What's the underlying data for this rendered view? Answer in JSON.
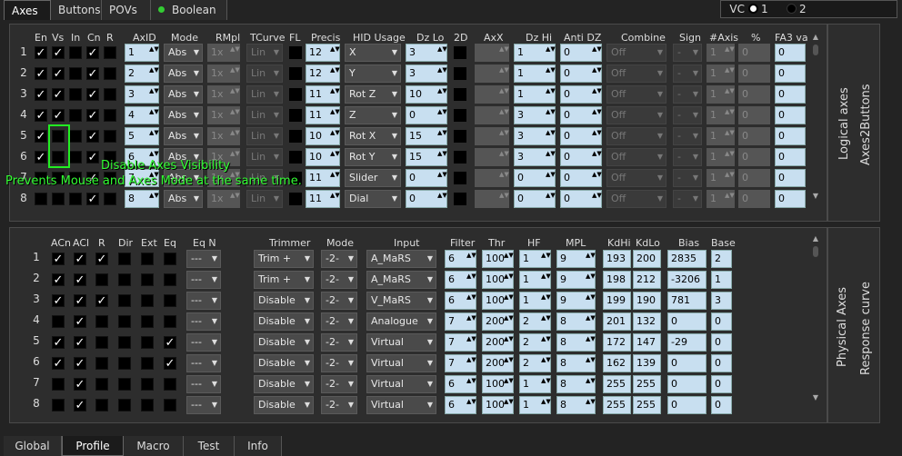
{
  "top_tabs": [
    "Axes",
    "Buttons",
    "POVs",
    "Boolean"
  ],
  "vc": {
    "label": "VC",
    "opt1": "1",
    "opt2": "2"
  },
  "logical": {
    "side_title1": "Logical axes",
    "side_title2": "Axes2Buttons",
    "headers": [
      "En",
      "Vs",
      "In",
      "Cn",
      "R",
      "AxID",
      "Mode",
      "RMpl",
      "TCurve",
      "FL",
      "Precis",
      "HID Usage",
      "Dz Lo",
      "2D",
      "AxX",
      "Dz Hi",
      "Anti DZ",
      "Combine",
      "Sign",
      "#Axis",
      "%",
      "FA3 va"
    ],
    "rows": [
      {
        "n": "1",
        "en": "✓",
        "vs": "✓",
        "in": "",
        "cn": "✓",
        "r": "",
        "axid": "1",
        "mode": "Abs",
        "rmpl": "1x",
        "tcurve": "Lin",
        "precis": "12",
        "hid": "X",
        "dzlo": "3",
        "axx": "",
        "dzhi": "1",
        "antidz": "0",
        "combine": "Off",
        "sign": "-",
        "naxis": "1",
        "pct": "0",
        "fa3": "0"
      },
      {
        "n": "2",
        "en": "✓",
        "vs": "✓",
        "in": "",
        "cn": "✓",
        "r": "",
        "axid": "2",
        "mode": "Abs",
        "rmpl": "1x",
        "tcurve": "Lin",
        "precis": "12",
        "hid": "Y",
        "dzlo": "3",
        "axx": "",
        "dzhi": "1",
        "antidz": "0",
        "combine": "Off",
        "sign": "-",
        "naxis": "1",
        "pct": "0",
        "fa3": "0"
      },
      {
        "n": "3",
        "en": "✓",
        "vs": "✓",
        "in": "",
        "cn": "✓",
        "r": "",
        "axid": "3",
        "mode": "Abs",
        "rmpl": "1x",
        "tcurve": "Lin",
        "precis": "11",
        "hid": "Rot Z",
        "dzlo": "10",
        "axx": "",
        "dzhi": "1",
        "antidz": "0",
        "combine": "Off",
        "sign": "-",
        "naxis": "1",
        "pct": "0",
        "fa3": "0"
      },
      {
        "n": "4",
        "en": "✓",
        "vs": "✓",
        "in": "",
        "cn": "✓",
        "r": "",
        "axid": "4",
        "mode": "Abs",
        "rmpl": "1x",
        "tcurve": "Lin",
        "precis": "11",
        "hid": "Z",
        "dzlo": "0",
        "axx": "",
        "dzhi": "3",
        "antidz": "0",
        "combine": "Off",
        "sign": "-",
        "naxis": "1",
        "pct": "0",
        "fa3": "0"
      },
      {
        "n": "5",
        "en": "✓",
        "vs": "",
        "in": "",
        "cn": "✓",
        "r": "",
        "axid": "5",
        "mode": "Abs",
        "rmpl": "1x",
        "tcurve": "Lin",
        "precis": "10",
        "hid": "Rot X",
        "dzlo": "15",
        "axx": "",
        "dzhi": "3",
        "antidz": "0",
        "combine": "Off",
        "sign": "-",
        "naxis": "1",
        "pct": "0",
        "fa3": "0"
      },
      {
        "n": "6",
        "en": "✓",
        "vs": "",
        "in": "",
        "cn": "✓",
        "r": "",
        "axid": "6",
        "mode": "Abs",
        "rmpl": "1x",
        "tcurve": "Lin",
        "precis": "10",
        "hid": "Rot Y",
        "dzlo": "15",
        "axx": "",
        "dzhi": "3",
        "antidz": "0",
        "combine": "Off",
        "sign": "-",
        "naxis": "1",
        "pct": "0",
        "fa3": "0"
      },
      {
        "n": "7",
        "en": "",
        "vs": "",
        "in": "",
        "cn": "✓",
        "r": "",
        "axid": "7",
        "mode": "Abs",
        "rmpl": "1x",
        "tcurve": "Lin",
        "precis": "11",
        "hid": "Slider",
        "dzlo": "0",
        "axx": "",
        "dzhi": "0",
        "antidz": "0",
        "combine": "Off",
        "sign": "-",
        "naxis": "1",
        "pct": "0",
        "fa3": "0"
      },
      {
        "n": "8",
        "en": "",
        "vs": "",
        "in": "",
        "cn": "✓",
        "r": "",
        "axid": "8",
        "mode": "Abs",
        "rmpl": "1x",
        "tcurve": "Lin",
        "precis": "11",
        "hid": "Dial",
        "dzlo": "0",
        "axx": "",
        "dzhi": "0",
        "antidz": "0",
        "combine": "Off",
        "sign": "-",
        "naxis": "1",
        "pct": "0",
        "fa3": "0"
      }
    ],
    "tooltip1": "Disable Axes Visibility",
    "tooltip2": "Prevents Mouse and Axes Mode at the same time."
  },
  "physical": {
    "side_title1": "Physical Axes",
    "side_title2": "Response curve",
    "headers": [
      "ACn",
      "ACl",
      "R",
      "Dir",
      "Ext",
      "Eq",
      "Eq N",
      "Trimmer",
      "Mode",
      "Input",
      "Filter",
      "Thr",
      "HF",
      "MPL",
      "KdHi",
      "KdLo",
      "Bias",
      "Base"
    ],
    "rows": [
      {
        "n": "1",
        "acn": "✓",
        "acl": "✓",
        "r": "✓",
        "dir": "",
        "ext": "",
        "eq": "",
        "eqn": "---",
        "trim": "Trim +",
        "mode": "-2-",
        "input": "A_MaRS",
        "filter": "6",
        "thr": "100",
        "hf": "1",
        "mpl": "9",
        "kdhi": "193",
        "kdlo": "200",
        "bias": "2835",
        "base": "2"
      },
      {
        "n": "2",
        "acn": "✓",
        "acl": "✓",
        "r": "",
        "dir": "",
        "ext": "",
        "eq": "",
        "eqn": "---",
        "trim": "Trim +",
        "mode": "-2-",
        "input": "A_MaRS",
        "filter": "6",
        "thr": "100",
        "hf": "1",
        "mpl": "9",
        "kdhi": "198",
        "kdlo": "212",
        "bias": "-3206",
        "base": "1"
      },
      {
        "n": "3",
        "acn": "✓",
        "acl": "✓",
        "r": "✓",
        "dir": "",
        "ext": "",
        "eq": "",
        "eqn": "---",
        "trim": "Disable",
        "mode": "-2-",
        "input": "V_MaRS",
        "filter": "6",
        "thr": "100",
        "hf": "1",
        "mpl": "9",
        "kdhi": "199",
        "kdlo": "190",
        "bias": "781",
        "base": "3"
      },
      {
        "n": "4",
        "acn": "",
        "acl": "✓",
        "r": "",
        "dir": "",
        "ext": "",
        "eq": "",
        "eqn": "---",
        "trim": "Disable",
        "mode": "-2-",
        "input": "Analogue",
        "filter": "7",
        "thr": "200",
        "hf": "2",
        "mpl": "8",
        "kdhi": "201",
        "kdlo": "132",
        "bias": "0",
        "base": "0"
      },
      {
        "n": "5",
        "acn": "✓",
        "acl": "✓",
        "r": "",
        "dir": "",
        "ext": "",
        "eq": "✓",
        "eqn": "---",
        "trim": "Disable",
        "mode": "-2-",
        "input": "Virtual",
        "filter": "7",
        "thr": "200",
        "hf": "2",
        "mpl": "8",
        "kdhi": "172",
        "kdlo": "147",
        "bias": "-29",
        "base": "0"
      },
      {
        "n": "6",
        "acn": "✓",
        "acl": "✓",
        "r": "",
        "dir": "",
        "ext": "",
        "eq": "✓",
        "eqn": "---",
        "trim": "Disable",
        "mode": "-2-",
        "input": "Virtual",
        "filter": "7",
        "thr": "200",
        "hf": "2",
        "mpl": "8",
        "kdhi": "162",
        "kdlo": "139",
        "bias": "0",
        "base": "0"
      },
      {
        "n": "7",
        "acn": "",
        "acl": "✓",
        "r": "",
        "dir": "",
        "ext": "",
        "eq": "",
        "eqn": "---",
        "trim": "Disable",
        "mode": "-2-",
        "input": "Virtual",
        "filter": "6",
        "thr": "100",
        "hf": "1",
        "mpl": "8",
        "kdhi": "255",
        "kdlo": "255",
        "bias": "0",
        "base": "0"
      },
      {
        "n": "8",
        "acn": "",
        "acl": "✓",
        "r": "",
        "dir": "",
        "ext": "",
        "eq": "",
        "eqn": "---",
        "trim": "Disable",
        "mode": "-2-",
        "input": "Virtual",
        "filter": "6",
        "thr": "100",
        "hf": "1",
        "mpl": "8",
        "kdhi": "255",
        "kdlo": "255",
        "bias": "0",
        "base": "0"
      }
    ]
  },
  "bottom_tabs": [
    "Global",
    "Profile",
    "Macro",
    "Test",
    "Info"
  ],
  "colors": {
    "input_bg": "#c8dff0",
    "tooltip": "#33ff33",
    "led": "#3c3"
  }
}
